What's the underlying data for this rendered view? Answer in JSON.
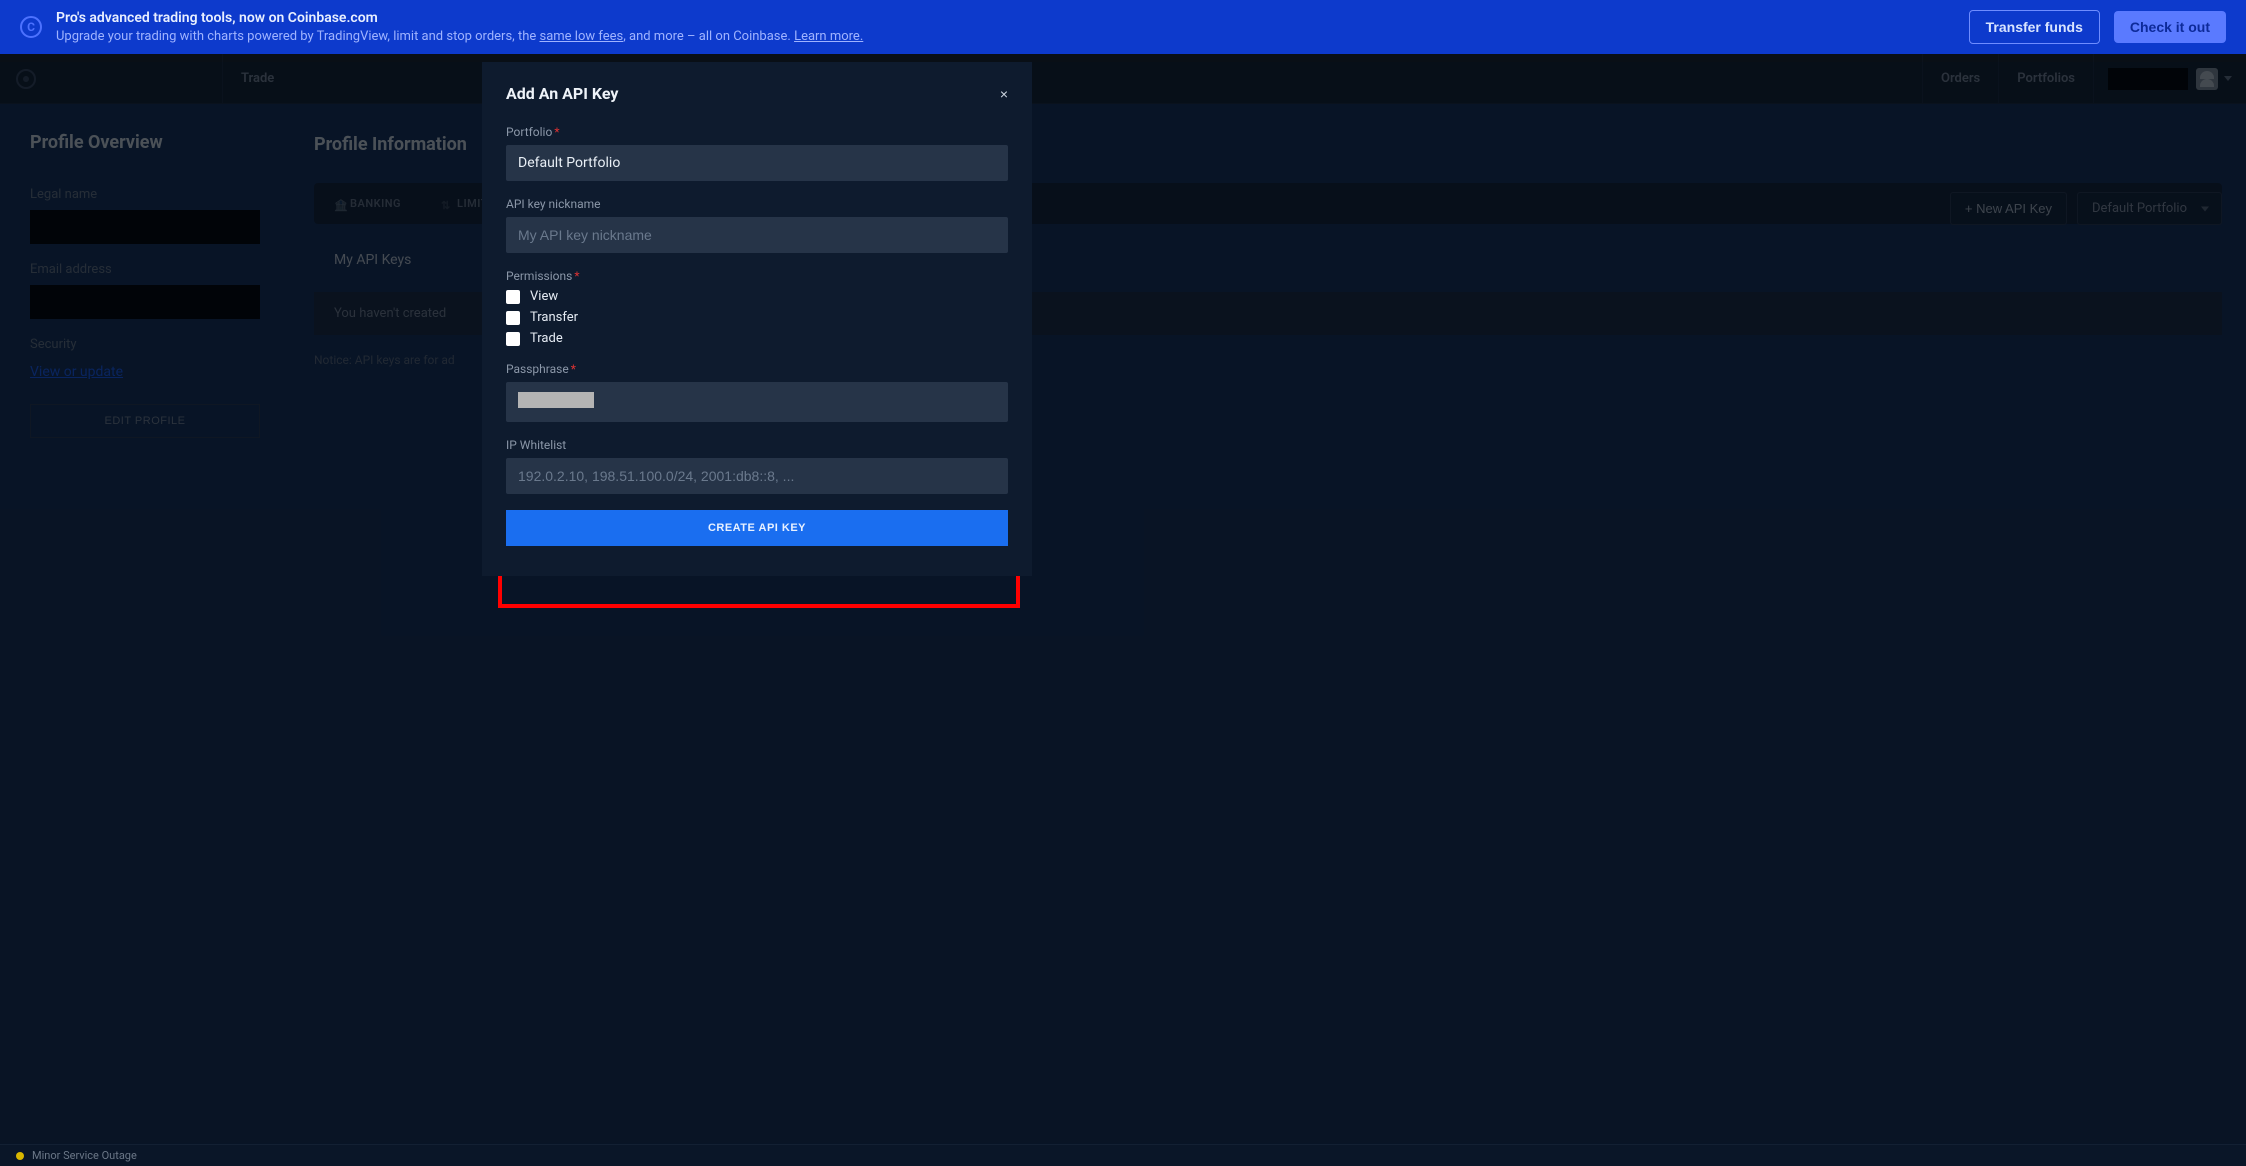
{
  "banner": {
    "title": "Pro's advanced trading tools, now on Coinbase.com",
    "sub_a": "Upgrade your trading with charts powered by TradingView, limit and stop orders, the ",
    "sub_link1": "same low fees",
    "sub_b": ", and more – all on Coinbase. ",
    "sub_link2": "Learn more.",
    "btn_transfer": "Transfer funds",
    "btn_check": "Check it out"
  },
  "topnav": {
    "trade": "Trade",
    "orders": "Orders",
    "portfolios": "Portfolios"
  },
  "sidebar": {
    "title": "Profile Overview",
    "legal_name_label": "Legal name",
    "email_label": "Email address",
    "security_label": "Security",
    "security_link": "View or update",
    "edit_btn": "EDIT PROFILE"
  },
  "content": {
    "title": "Profile Information",
    "tabs": {
      "banking": "BANKING",
      "limits": "LIMITS"
    },
    "api_title": "My API Keys",
    "new_key_btn": "+ New API Key",
    "portfolio_select": "Default Portfolio",
    "empty_msg": "You haven't created",
    "notice": "Notice: API keys are for ad"
  },
  "modal": {
    "title": "Add An API Key",
    "portfolio_label": "Portfolio",
    "portfolio_value": "Default Portfolio",
    "nickname_label": "API key nickname",
    "nickname_placeholder": "My API key nickname",
    "permissions_label": "Permissions",
    "perm_view": "View",
    "perm_transfer": "Transfer",
    "perm_trade": "Trade",
    "passphrase_label": "Passphrase",
    "ip_label": "IP Whitelist",
    "ip_placeholder": "192.0.2.10, 198.51.100.0/24, 2001:db8::8, ...",
    "create_btn": "CREATE API KEY",
    "close": "×"
  },
  "footer": {
    "status": "Minor Service Outage"
  }
}
